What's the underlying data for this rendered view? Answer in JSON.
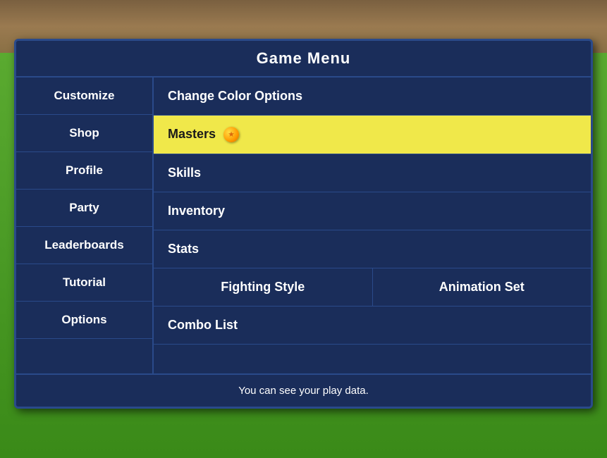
{
  "background": {
    "dirt_color": "#8B7355",
    "grass_color": "#4a8a2a"
  },
  "menu": {
    "title": "Game Menu",
    "nav_items": [
      {
        "label": "Customize",
        "id": "customize"
      },
      {
        "label": "Shop",
        "id": "shop"
      },
      {
        "label": "Profile",
        "id": "profile"
      },
      {
        "label": "Party",
        "id": "party"
      },
      {
        "label": "Leaderboards",
        "id": "leaderboards"
      },
      {
        "label": "Tutorial",
        "id": "tutorial"
      },
      {
        "label": "Options",
        "id": "options"
      }
    ],
    "content_rows": [
      {
        "id": "change-color",
        "label": "Change Color Options",
        "highlighted": false,
        "split": false
      },
      {
        "id": "masters",
        "label": "Masters",
        "highlighted": true,
        "split": false
      },
      {
        "id": "skills",
        "label": "Skills",
        "highlighted": false,
        "split": false
      },
      {
        "id": "inventory",
        "label": "Inventory",
        "highlighted": false,
        "split": false
      },
      {
        "id": "stats",
        "label": "Stats",
        "highlighted": false,
        "split": false
      },
      {
        "id": "fighting-style",
        "label": "Fighting Style",
        "highlighted": false,
        "split": true,
        "label2": "Animation Set"
      },
      {
        "id": "combo-list",
        "label": "Combo List",
        "highlighted": false,
        "split": false
      }
    ],
    "footer_text": "You can see your play data."
  }
}
